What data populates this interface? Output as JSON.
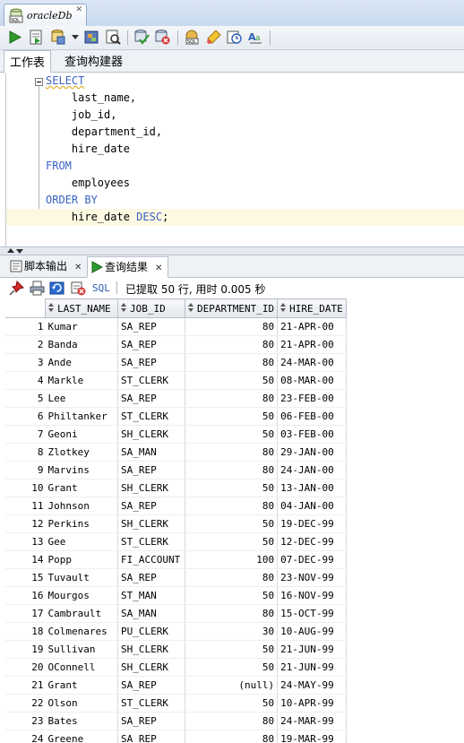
{
  "document_tab": {
    "title": "oracleDb"
  },
  "editor_tabs": [
    "工作表",
    "查询构建器"
  ],
  "sql": {
    "lines": [
      [
        {
          "t": "SELECT",
          "kw": true
        }
      ],
      [
        {
          "t": "    last_name,",
          "kw": false
        }
      ],
      [
        {
          "t": "    job_id,",
          "kw": false
        }
      ],
      [
        {
          "t": "    department_id,",
          "kw": false
        }
      ],
      [
        {
          "t": "    hire_date",
          "kw": false
        }
      ],
      [
        {
          "t": "FROM",
          "kw": true
        }
      ],
      [
        {
          "t": "    employees",
          "kw": false
        }
      ],
      [
        {
          "t": "ORDER BY",
          "kw": true
        }
      ],
      [
        {
          "t": "    hire_date ",
          "kw": false
        },
        {
          "t": "DESC",
          "kw": true
        },
        {
          "t": ";",
          "kw": false
        }
      ]
    ]
  },
  "output_tabs": {
    "script_output": "脚本输出",
    "query_result": "查询结果"
  },
  "results_toolbar": {
    "sql_label": "SQL",
    "status": "已提取 50 行, 用时 0.005 秒"
  },
  "grid": {
    "columns": [
      "LAST_NAME",
      "JOB_ID",
      "DEPARTMENT_ID",
      "HIRE_DATE"
    ],
    "rows": [
      [
        "1",
        "Kumar",
        "SA_REP",
        "80",
        "21-APR-00"
      ],
      [
        "2",
        "Banda",
        "SA_REP",
        "80",
        "21-APR-00"
      ],
      [
        "3",
        "Ande",
        "SA_REP",
        "80",
        "24-MAR-00"
      ],
      [
        "4",
        "Markle",
        "ST_CLERK",
        "50",
        "08-MAR-00"
      ],
      [
        "5",
        "Lee",
        "SA_REP",
        "80",
        "23-FEB-00"
      ],
      [
        "6",
        "Philtanker",
        "ST_CLERK",
        "50",
        "06-FEB-00"
      ],
      [
        "7",
        "Geoni",
        "SH_CLERK",
        "50",
        "03-FEB-00"
      ],
      [
        "8",
        "Zlotkey",
        "SA_MAN",
        "80",
        "29-JAN-00"
      ],
      [
        "9",
        "Marvins",
        "SA_REP",
        "80",
        "24-JAN-00"
      ],
      [
        "10",
        "Grant",
        "SH_CLERK",
        "50",
        "13-JAN-00"
      ],
      [
        "11",
        "Johnson",
        "SA_REP",
        "80",
        "04-JAN-00"
      ],
      [
        "12",
        "Perkins",
        "SH_CLERK",
        "50",
        "19-DEC-99"
      ],
      [
        "13",
        "Gee",
        "ST_CLERK",
        "50",
        "12-DEC-99"
      ],
      [
        "14",
        "Popp",
        "FI_ACCOUNT",
        "100",
        "07-DEC-99"
      ],
      [
        "15",
        "Tuvault",
        "SA_REP",
        "80",
        "23-NOV-99"
      ],
      [
        "16",
        "Mourgos",
        "ST_MAN",
        "50",
        "16-NOV-99"
      ],
      [
        "17",
        "Cambrault",
        "SA_MAN",
        "80",
        "15-OCT-99"
      ],
      [
        "18",
        "Colmenares",
        "PU_CLERK",
        "30",
        "10-AUG-99"
      ],
      [
        "19",
        "Sullivan",
        "SH_CLERK",
        "50",
        "21-JUN-99"
      ],
      [
        "20",
        "OConnell",
        "SH_CLERK",
        "50",
        "21-JUN-99"
      ],
      [
        "21",
        "Grant",
        "SA_REP",
        "(null)",
        "24-MAY-99"
      ],
      [
        "22",
        "Olson",
        "ST_CLERK",
        "50",
        "10-APR-99"
      ],
      [
        "23",
        "Bates",
        "SA_REP",
        "80",
        "24-MAR-99"
      ],
      [
        "24",
        "Greene",
        "SA_REP",
        "80",
        "19-MAR-99"
      ]
    ]
  }
}
